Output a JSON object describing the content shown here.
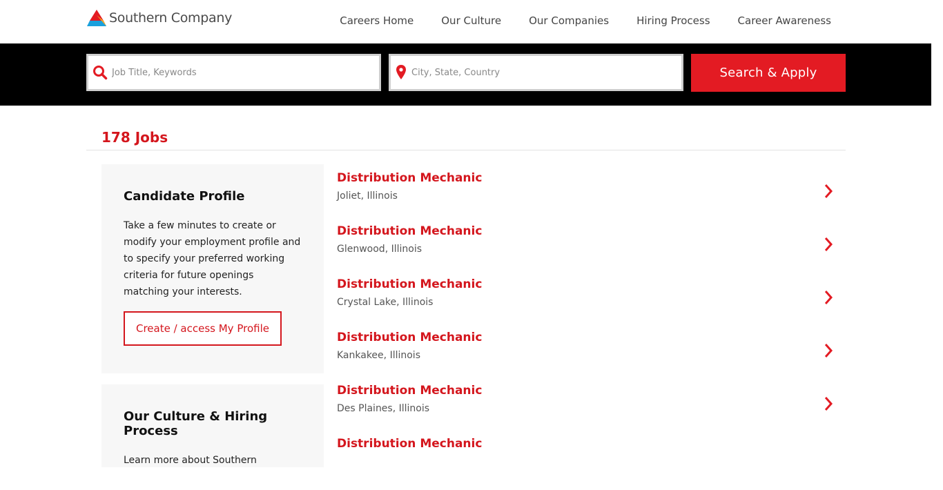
{
  "brand": {
    "name": "Southern Company",
    "accent": "#e31b23"
  },
  "nav": [
    {
      "label": "Careers Home"
    },
    {
      "label": "Our Culture"
    },
    {
      "label": "Our Companies"
    },
    {
      "label": "Hiring Process"
    },
    {
      "label": "Career Awareness"
    }
  ],
  "search": {
    "keyword_placeholder": "Job Title, Keywords",
    "location_placeholder": "City, State, Country",
    "button_label": "Search & Apply",
    "keyword_icon": "search-icon",
    "location_icon": "map-pin-icon"
  },
  "results": {
    "count_label": "178 Jobs"
  },
  "candidate_profile": {
    "title": "Candidate Profile",
    "body": "Take a few minutes to create or modify your employment profile and to specify your preferred working criteria for future openings matching your interests.",
    "button_label": "Create / access My Profile"
  },
  "culture_card": {
    "title": "Our Culture & Hiring Process",
    "body": "Learn more about Southern"
  },
  "jobs": [
    {
      "title": "Distribution Mechanic",
      "location": "Joliet, Illinois"
    },
    {
      "title": "Distribution Mechanic",
      "location": "Glenwood, Illinois"
    },
    {
      "title": "Distribution Mechanic",
      "location": "Crystal Lake, Illinois"
    },
    {
      "title": "Distribution Mechanic",
      "location": "Kankakee, Illinois"
    },
    {
      "title": "Distribution Mechanic",
      "location": "Des Plaines, Illinois"
    },
    {
      "title": "Distribution Mechanic",
      "location": ""
    }
  ]
}
